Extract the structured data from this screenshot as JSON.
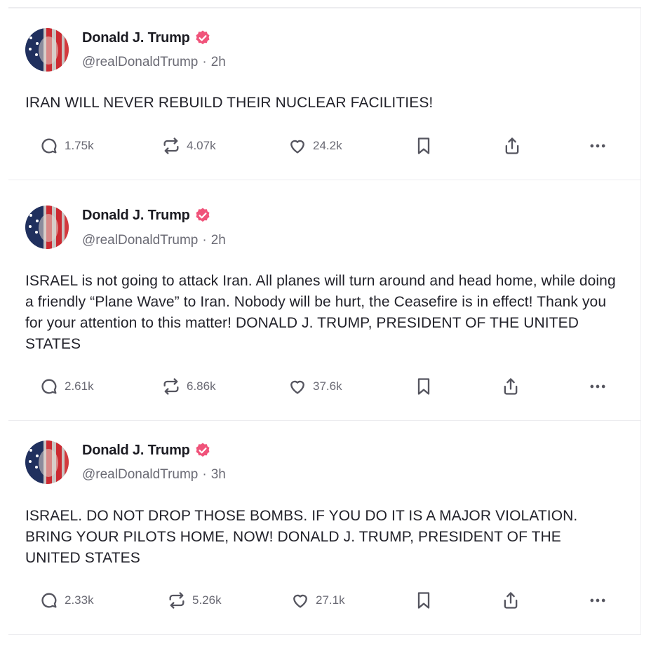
{
  "posts": [
    {
      "author_name": "Donald J. Trump",
      "handle": "@realDonaldTrump",
      "separator": "·",
      "time": "2h",
      "text": "IRAN WILL NEVER REBUILD THEIR NUCLEAR FACILITIES!",
      "replies": "1.75k",
      "reposts": "4.07k",
      "likes": "24.2k"
    },
    {
      "author_name": "Donald J. Trump",
      "handle": "@realDonaldTrump",
      "separator": "·",
      "time": "2h",
      "text": "ISRAEL is not going to attack Iran. All planes will turn around and head home, while doing a friendly “Plane Wave” to Iran. Nobody will be hurt, the Ceasefire is in effect! Thank you for your attention to this matter! DONALD J. TRUMP, PRESIDENT OF THE UNITED STATES",
      "replies": "2.61k",
      "reposts": "6.86k",
      "likes": "37.6k"
    },
    {
      "author_name": "Donald J. Trump",
      "handle": "@realDonaldTrump",
      "separator": "·",
      "time": "3h",
      "text": "ISRAEL. DO NOT DROP THOSE BOMBS. IF YOU DO IT IS A MAJOR VIOLATION. BRING YOUR PILOTS HOME, NOW!  DONALD J. TRUMP, PRESIDENT OF THE UNITED STATES",
      "replies": "2.33k",
      "reposts": "5.26k",
      "likes": "27.1k"
    }
  ],
  "icons": {
    "reply": "reply-icon",
    "repost": "repost-icon",
    "like": "heart-icon",
    "bookmark": "bookmark-icon",
    "share": "share-icon",
    "more": "more-icon",
    "verified": "verified-badge-icon"
  },
  "colors": {
    "verified_badge": "#f0537a",
    "text": "#22222a",
    "muted": "#6b6b75"
  }
}
